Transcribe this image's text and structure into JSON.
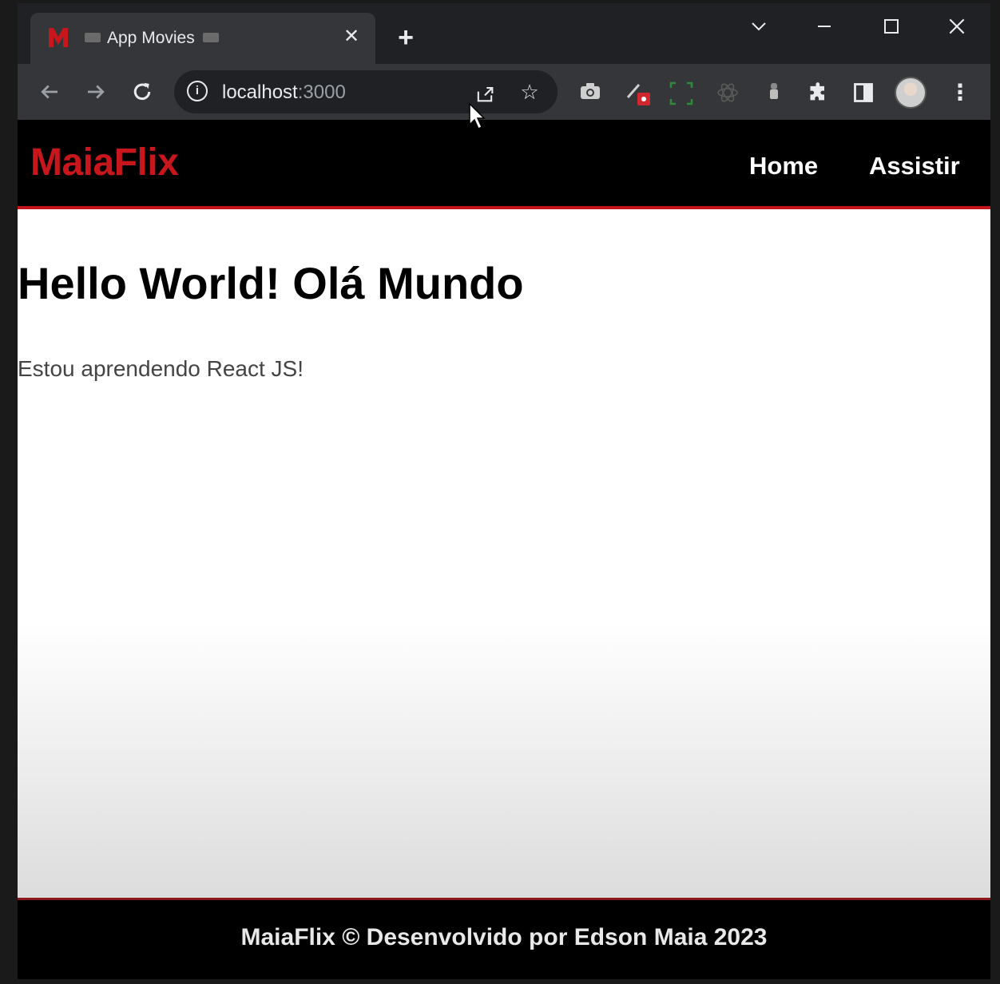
{
  "browser": {
    "tab": {
      "title": "App Movies",
      "favicon": "maiaflix-m-logo"
    },
    "new_tab_label": "+",
    "window_controls": {
      "dropdown": "chevron-down-icon",
      "minimize": "minimize-icon",
      "maximize": "maximize-icon",
      "close": "close-icon"
    },
    "address": {
      "host": "localhost",
      "port": ":3000"
    }
  },
  "site": {
    "logo": "MaiaFlix",
    "nav": [
      "Home",
      "Assistir"
    ],
    "heading": "Hello World! Olá Mundo",
    "paragraph": "Estou aprendendo React JS!",
    "footer": "MaiaFlix © Desenvolvido por Edson Maia 2023"
  },
  "colors": {
    "brand_red": "#c8161d",
    "header_bg": "#000000",
    "chrome_dark": "#202124",
    "chrome_toolbar": "#35363a"
  }
}
